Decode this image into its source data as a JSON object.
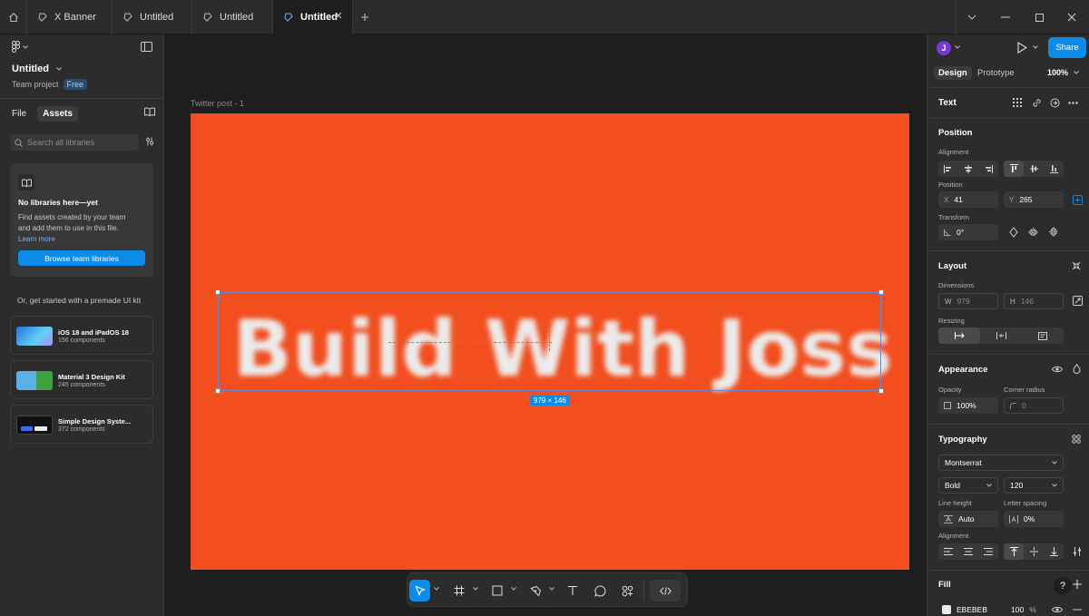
{
  "tabs": [
    {
      "label": "X Banner"
    },
    {
      "label": "Untitled"
    },
    {
      "label": "Untitled"
    },
    {
      "label": "Untitled"
    }
  ],
  "left_panel": {
    "file_name": "Untitled",
    "project": "Team project",
    "plan_badge": "Free",
    "tab_file": "File",
    "tab_assets": "Assets",
    "search_placeholder": "Search all libraries",
    "empty_title": "No libraries here—yet",
    "empty_desc_line1": "Find assets created by your team",
    "empty_desc_line2": "and add them to use in this file.",
    "learn_more": "Learn more",
    "browse_button": "Browse team libraries",
    "premade_label": "Or, get started with a premade UI kit",
    "kits": [
      {
        "name": "iOS 18 and iPadOS 18",
        "count": "156 components"
      },
      {
        "name": "Material 3 Design Kit",
        "count": "245 components"
      },
      {
        "name": "Simple Design Syste...",
        "count": "372 components"
      }
    ]
  },
  "canvas": {
    "frame_label": "Twitter post - 1",
    "frame_color": "#F24E1E",
    "text_content": "Build With Joss",
    "dimension_badge": "979 × 146"
  },
  "right_panel": {
    "avatar_initial": "J",
    "share": "Share",
    "tab_design": "Design",
    "tab_prototype": "Prototype",
    "zoom": "100%",
    "layer_type": "Text",
    "position_title": "Position",
    "alignment_label": "Alignment",
    "position_label": "Position",
    "x_label": "X",
    "x_value": "41",
    "y_label": "Y",
    "y_value": "265",
    "transform_label": "Transform",
    "rotation": "0°",
    "layout_title": "Layout",
    "dimensions_label": "Dimensions",
    "w_label": "W",
    "w_value": "979",
    "h_label": "H",
    "h_value": "146",
    "resizing_label": "Resizing",
    "appearance_title": "Appearance",
    "opacity_label": "Opacity",
    "opacity_value": "100%",
    "corner_label": "Corner radius",
    "corner_value": "0",
    "typography_title": "Typography",
    "font_family": "Montserrat",
    "font_weight": "Bold",
    "font_size": "120",
    "line_height_label": "Line height",
    "line_height_value": "Auto",
    "letter_spacing_label": "Letter spacing",
    "letter_spacing_value": "0%",
    "alignment2_label": "Alignment",
    "fill_title": "Fill",
    "fill_hex": "EBEBEB",
    "fill_opacity": "100",
    "fill_percent": "%",
    "help": "?"
  }
}
